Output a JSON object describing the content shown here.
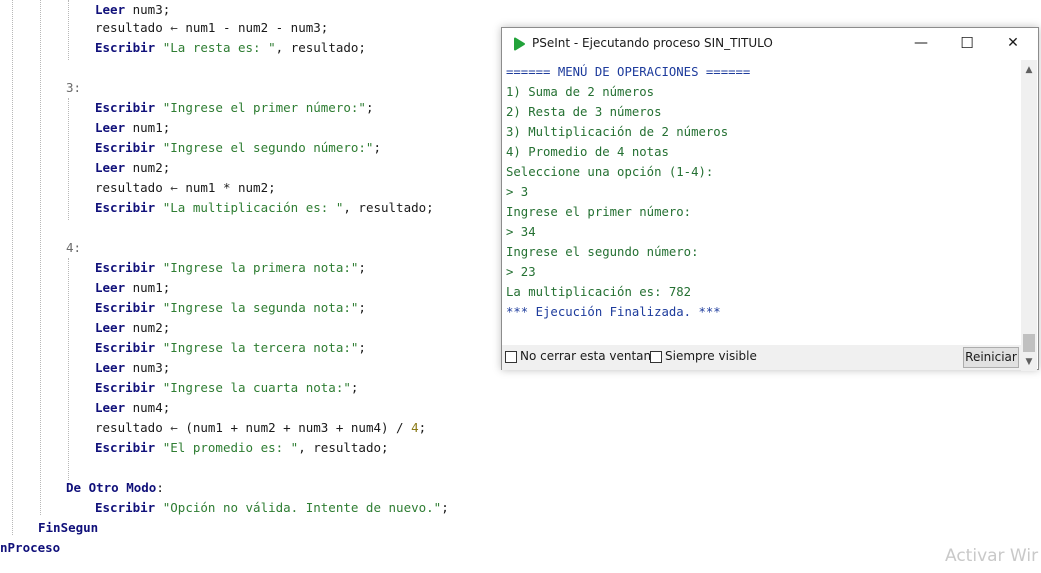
{
  "editor": {
    "lines": [
      [
        {
          "t": "kw",
          "v": "Leer"
        },
        {
          "t": "idf",
          "v": " num3;"
        }
      ],
      [
        {
          "t": "idf",
          "v": "resultado "
        },
        {
          "t": "op",
          "v": "←"
        },
        {
          "t": "idf",
          "v": " num1 - num2 - num3;"
        }
      ],
      [
        {
          "t": "kw",
          "v": "Escribir"
        },
        {
          "t": "str",
          "v": " \"La resta es: \""
        },
        {
          "t": "idf",
          "v": ", resultado;"
        }
      ],
      [
        {
          "t": "lbl",
          "v": "3:"
        }
      ],
      [
        {
          "t": "kw",
          "v": "Escribir"
        },
        {
          "t": "str",
          "v": " \"Ingrese el primer número:\""
        },
        {
          "t": "idf",
          "v": ";"
        }
      ],
      [
        {
          "t": "kw",
          "v": "Leer"
        },
        {
          "t": "idf",
          "v": " num1;"
        }
      ],
      [
        {
          "t": "kw",
          "v": "Escribir"
        },
        {
          "t": "str",
          "v": " \"Ingrese el segundo número:\""
        },
        {
          "t": "idf",
          "v": ";"
        }
      ],
      [
        {
          "t": "kw",
          "v": "Leer"
        },
        {
          "t": "idf",
          "v": " num2;"
        }
      ],
      [
        {
          "t": "idf",
          "v": "resultado "
        },
        {
          "t": "op",
          "v": "←"
        },
        {
          "t": "idf",
          "v": " num1 * num2;"
        }
      ],
      [
        {
          "t": "kw",
          "v": "Escribir"
        },
        {
          "t": "str",
          "v": " \"La multiplicación es: \""
        },
        {
          "t": "idf",
          "v": ", resultado;"
        }
      ],
      [
        {
          "t": "lbl",
          "v": "4:"
        }
      ],
      [
        {
          "t": "kw",
          "v": "Escribir"
        },
        {
          "t": "str",
          "v": " \"Ingrese la primera nota:\""
        },
        {
          "t": "idf",
          "v": ";"
        }
      ],
      [
        {
          "t": "kw",
          "v": "Leer"
        },
        {
          "t": "idf",
          "v": " num1;"
        }
      ],
      [
        {
          "t": "kw",
          "v": "Escribir"
        },
        {
          "t": "str",
          "v": " \"Ingrese la segunda nota:\""
        },
        {
          "t": "idf",
          "v": ";"
        }
      ],
      [
        {
          "t": "kw",
          "v": "Leer"
        },
        {
          "t": "idf",
          "v": " num2;"
        }
      ],
      [
        {
          "t": "kw",
          "v": "Escribir"
        },
        {
          "t": "str",
          "v": " \"Ingrese la tercera nota:\""
        },
        {
          "t": "idf",
          "v": ";"
        }
      ],
      [
        {
          "t": "kw",
          "v": "Leer"
        },
        {
          "t": "idf",
          "v": " num3;"
        }
      ],
      [
        {
          "t": "kw",
          "v": "Escribir"
        },
        {
          "t": "str",
          "v": " \"Ingrese la cuarta nota:\""
        },
        {
          "t": "idf",
          "v": ";"
        }
      ],
      [
        {
          "t": "kw",
          "v": "Leer"
        },
        {
          "t": "idf",
          "v": " num4;"
        }
      ],
      [
        {
          "t": "idf",
          "v": "resultado "
        },
        {
          "t": "op",
          "v": "←"
        },
        {
          "t": "idf",
          "v": " (num1 + num2 + num3 + num4) / "
        },
        {
          "t": "num",
          "v": "4"
        },
        {
          "t": "idf",
          "v": ";"
        }
      ],
      [
        {
          "t": "kw",
          "v": "Escribir"
        },
        {
          "t": "str",
          "v": " \"El promedio es: \""
        },
        {
          "t": "idf",
          "v": ", resultado;"
        }
      ],
      [
        {
          "t": "kw",
          "v": "De Otro Modo"
        },
        {
          "t": "idf",
          "v": ":"
        }
      ],
      [
        {
          "t": "kw",
          "v": "Escribir"
        },
        {
          "t": "str",
          "v": " \"Opción no válida. Intente de nuevo.\""
        },
        {
          "t": "idf",
          "v": ";"
        }
      ],
      [
        {
          "t": "kw",
          "v": "FinSegun"
        }
      ],
      [
        {
          "t": "kw",
          "v": "nProceso"
        }
      ]
    ],
    "watermark": "Activar Wir"
  },
  "console_window": {
    "title": "PSeInt - Ejecutando proceso SIN_TITULO",
    "minimize_icon": "—",
    "maximize_icon": "☐",
    "close_icon": "✕",
    "output": [
      "====== MENÚ DE OPERACIONES ======",
      "1) Suma de 2 números",
      "2) Resta de 3 números",
      "3) Multiplicación de 2 números",
      "4) Promedio de 4 notas",
      "Seleccione una opción (1-4):",
      "> 3",
      "Ingrese el primer número:",
      "> 34",
      "Ingrese el segundo número:",
      "> 23",
      "La multiplicación es: 782",
      "*** Ejecución Finalizada. ***"
    ],
    "no_cerrar_label": "No cerrar esta ventana",
    "siempre_visible_label": "Siempre visible",
    "reiniciar_label": "Reiniciar",
    "scroll_up": "▲",
    "scroll_down": "▼"
  },
  "colors": {
    "keyword": "#10107a",
    "string": "#2e7d32",
    "console_text": "#247032",
    "console_header": "#1d3b9c",
    "pseint_icon": "#22a33a"
  }
}
